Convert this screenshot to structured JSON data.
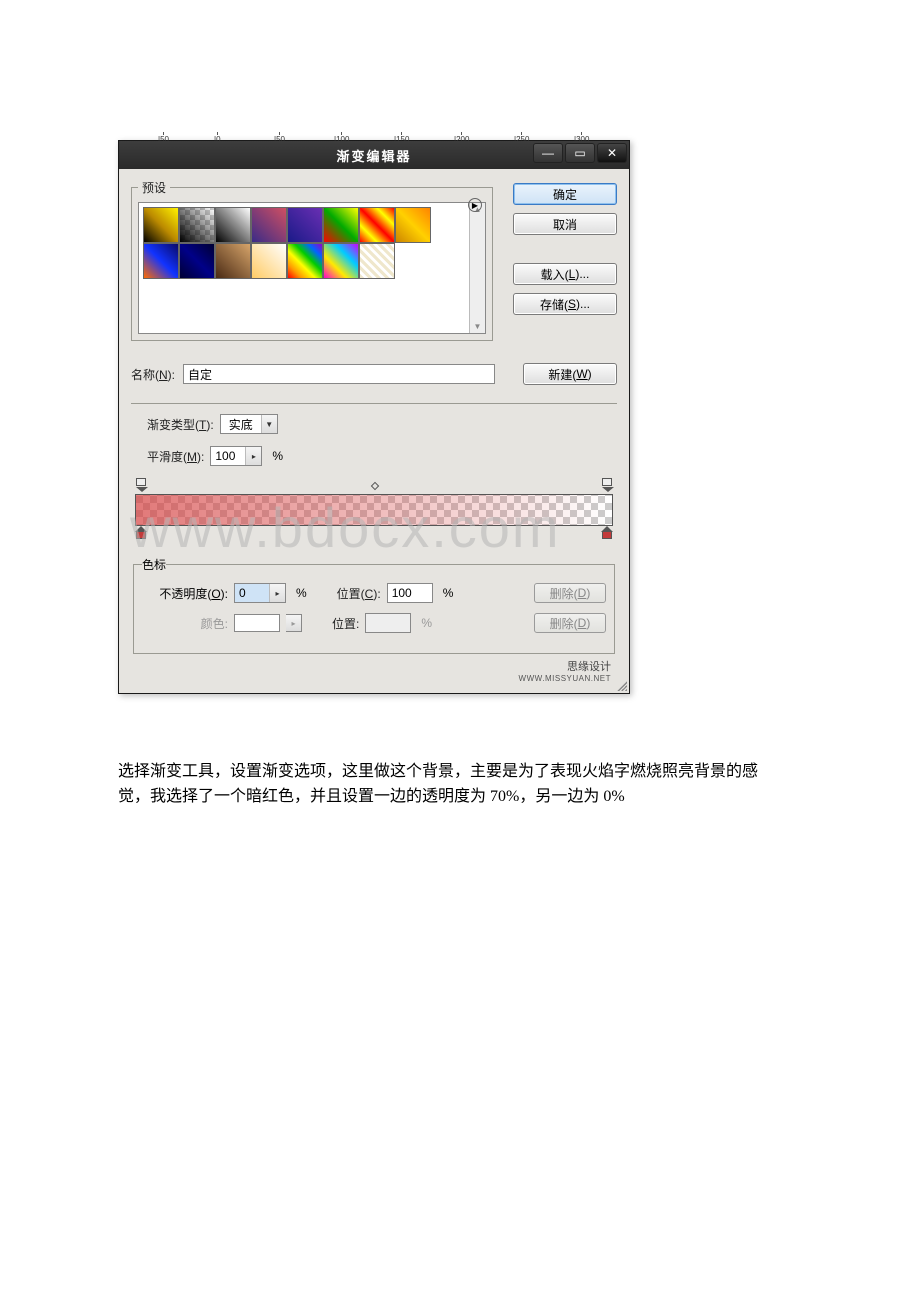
{
  "ruler_ticks": [
    "|50",
    "|0",
    "|50",
    "|100",
    "|150",
    "|200",
    "|250",
    "|300"
  ],
  "dialog": {
    "title": "渐变编辑器",
    "preset_legend": "预设",
    "buttons": {
      "ok": "确定",
      "cancel": "取消",
      "load": "载入(L)...",
      "save": "存储(S)...",
      "new": "新建(W)"
    },
    "name_label": "名称(N):",
    "name_value": "自定",
    "type_label": "渐变类型(T):",
    "type_value": "实底",
    "smooth_label": "平滑度(M):",
    "smooth_value": "100",
    "pct": "%",
    "stops_legend": "色标",
    "opacity_label": "不透明度(O):",
    "opacity_value": "0",
    "pos_label": "位置(C):",
    "pos_value": "100",
    "delete_label": "删除(D)",
    "color_label": "颜色:",
    "pos2_label": "位置:",
    "footer_credit": "思缘设计",
    "footer_url": "WWW.MISSYUAN.NET"
  },
  "watermark": "www.bdocx.com",
  "description": "选择渐变工具，设置渐变选项，这里做这个背景，主要是为了表现火焰字燃烧照亮背景的感觉，我选择了一个暗红色，并且设置一边的透明度为 70%，另一边为 0%"
}
